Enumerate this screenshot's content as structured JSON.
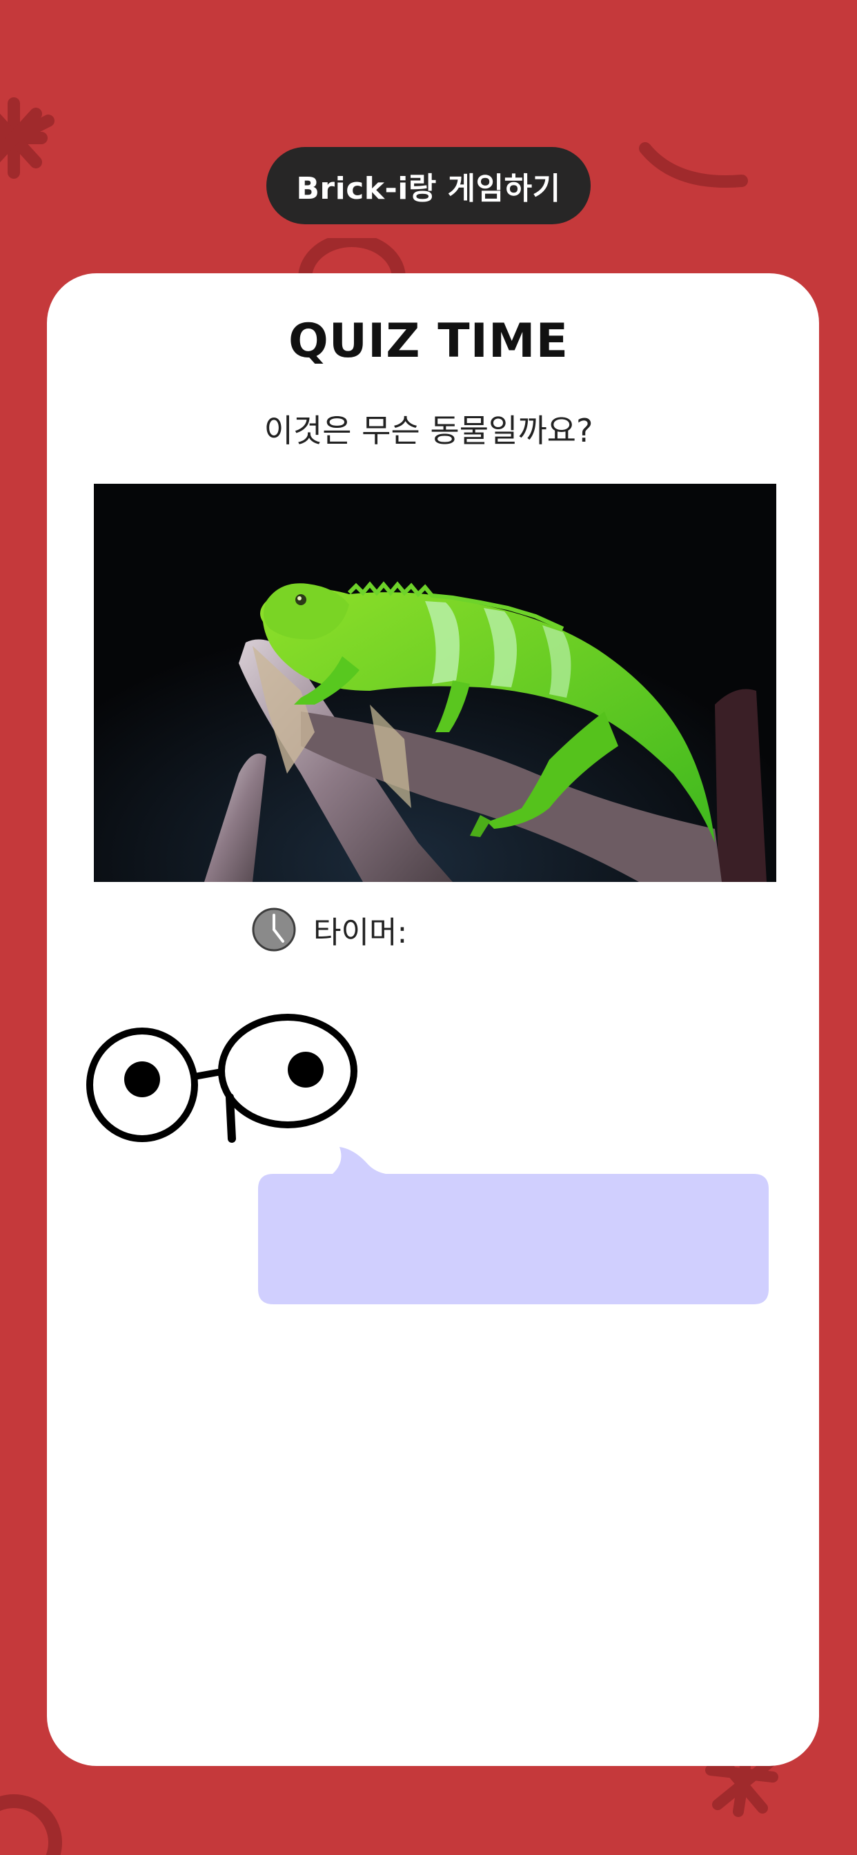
{
  "header": {
    "title": "Brick-i랑 게임하기"
  },
  "quiz": {
    "heading": "QUIZ TIME",
    "question": "이것은 무슨 동물일까요?",
    "image_subject": "green iguana on branch",
    "timer_label": "타이머:",
    "answer_text": ""
  },
  "icons": {
    "timer": "clock-icon",
    "mascot": "mascot-face-icon"
  },
  "colors": {
    "background": "#c5393b",
    "card": "#ffffff",
    "pill": "#272626",
    "bubble": "#d0cffe",
    "decoration": "#a02a2c"
  }
}
